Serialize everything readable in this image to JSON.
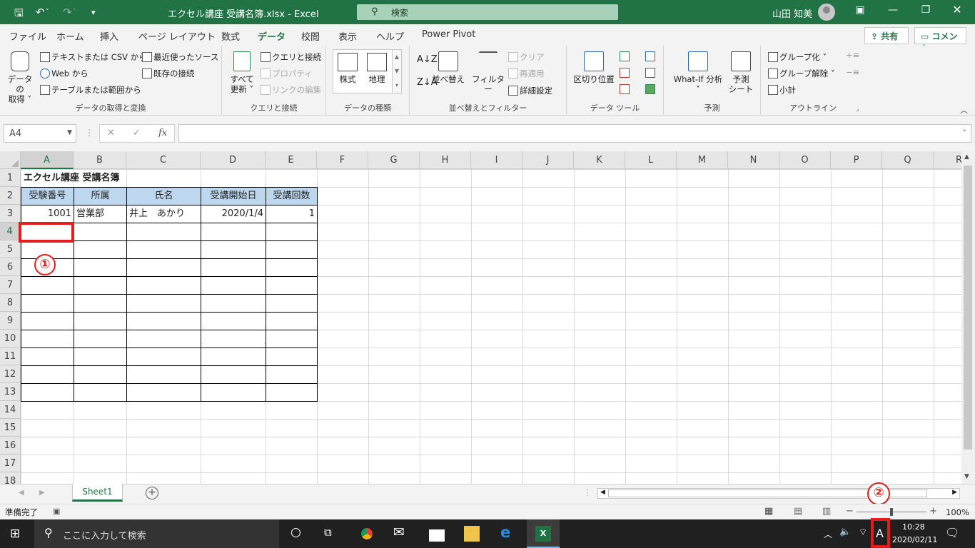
{
  "window": {
    "title": "エクセル講座 受講名簿.xlsx  -  Excel",
    "search_label": "検索",
    "user_name": "山田 知美",
    "accent": "#217346"
  },
  "menu": {
    "tabs": [
      "ファイル",
      "ホーム",
      "挿入",
      "ページ レイアウト",
      "数式",
      "データ",
      "校閲",
      "表示",
      "ヘルプ",
      "Power Pivot"
    ],
    "active": "データ",
    "share": "共有",
    "comment": "コメント"
  },
  "ribbon": {
    "get_data": {
      "label": "データの取得と変換",
      "get_data_line1": "データの",
      "get_data_line2": "取得 ˅",
      "text_csv": "テキストまたは CSV から",
      "web": "Web から",
      "table_range": "テーブルまたは範囲から",
      "recent_sources": "最近使ったソース",
      "existing_conn": "既存の接続"
    },
    "queries": {
      "label": "クエリと接続",
      "refresh_line1": "すべて",
      "refresh_line2": "更新 ˅",
      "queries_conn": "クエリと接続",
      "properties": "プロパティ",
      "edit_links": "リンクの編集"
    },
    "data_types": {
      "label": "データの種類",
      "stocks": "株式",
      "geography": "地理"
    },
    "sort_filter": {
      "label": "並べ替えとフィルター",
      "sort": "並べ替え",
      "filter": "フィルター",
      "clear": "クリア",
      "reapply": "再適用",
      "advanced": "詳細設定"
    },
    "data_tools": {
      "label": "データ ツール",
      "text_to_columns": "区切り位置"
    },
    "forecast": {
      "label": "予測",
      "what_if": "What-If 分析",
      "forecast_sheet_line1": "予測",
      "forecast_sheet_line2": "シート"
    },
    "outline": {
      "label": "アウトライン",
      "group": "グループ化",
      "ungroup": "グループ解除",
      "subtotal": "小計"
    }
  },
  "formula_bar": {
    "name_box": "A4",
    "fx": "fx",
    "formula": ""
  },
  "sheet": {
    "columns": [
      "A",
      "B",
      "C",
      "D",
      "E",
      "F",
      "G",
      "H",
      "I",
      "J",
      "K",
      "L",
      "M",
      "N",
      "O",
      "P",
      "Q",
      "R"
    ],
    "rows": [
      "1",
      "2",
      "3",
      "4",
      "5",
      "6",
      "7",
      "8",
      "9",
      "10",
      "11",
      "12",
      "13",
      "14",
      "15",
      "16",
      "17",
      "18"
    ],
    "title": "エクセル講座 受講名簿",
    "headers": [
      "受験番号",
      "所属",
      "氏名",
      "受講開始日",
      "受講回数"
    ],
    "record": [
      "1001",
      "営業部",
      "井上　あかり",
      "2020/1/4",
      "1"
    ],
    "selected_cell": "A4"
  },
  "annotations": {
    "marker1": "①",
    "marker2": "②",
    "highlight_color": "#e51c1c"
  },
  "sheet_tabs": [
    "Sheet1"
  ],
  "status": {
    "ready": "準備完了",
    "zoom": "100%"
  },
  "taskbar": {
    "search_placeholder": "ここに入力して検索",
    "ime": "A",
    "time": "10:28",
    "date": "2020/02/11"
  }
}
